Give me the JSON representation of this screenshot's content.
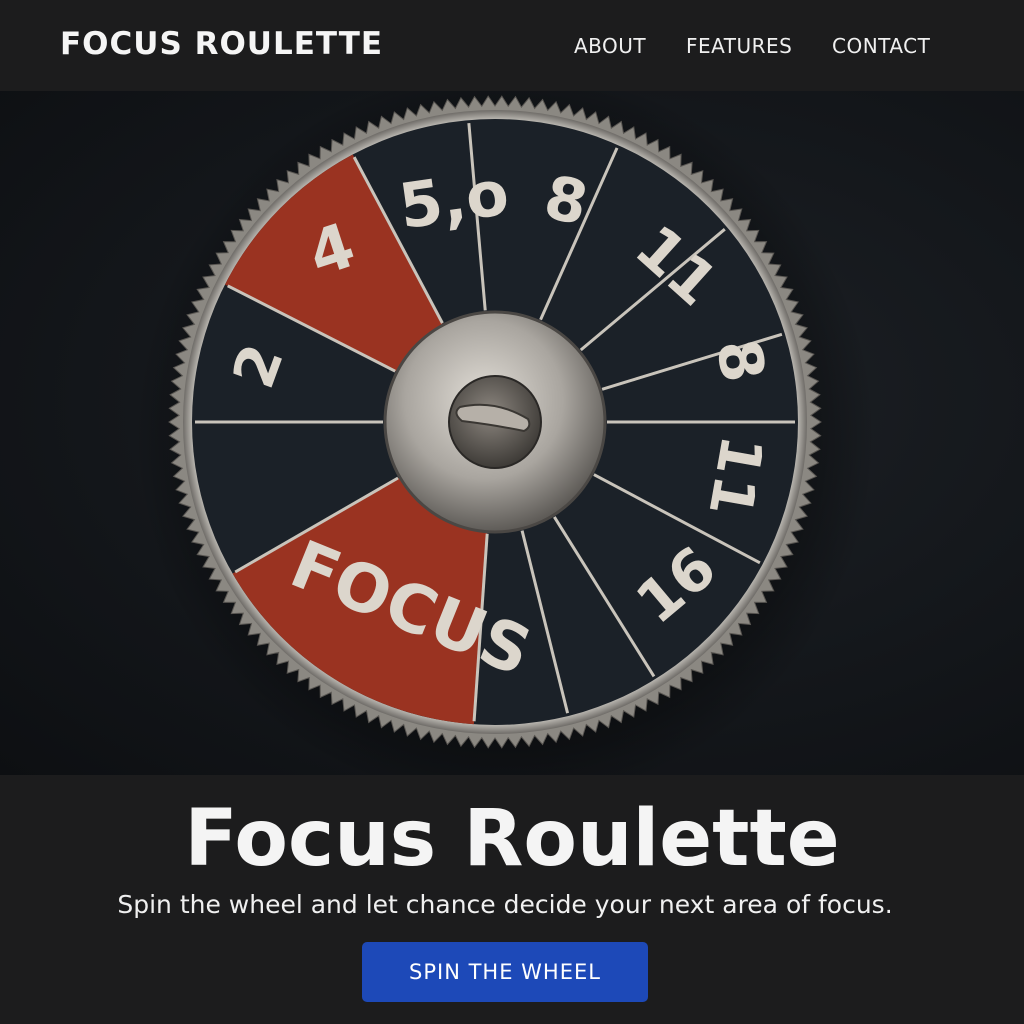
{
  "nav": {
    "logo": "FOCUS ROULETTE",
    "links": [
      "ABOUT",
      "FEATURES",
      "CONTACT"
    ]
  },
  "wheel": {
    "segment_labels": [
      "5,o",
      "8",
      "11",
      "8",
      "11",
      "16",
      "FOCUS",
      "2",
      "4"
    ],
    "colors": {
      "dark": "#1b2128",
      "red": "#9a3321",
      "rim": "#b9b6b0",
      "text": "#dcd6cc"
    }
  },
  "hero": {
    "title": "Focus Roulette",
    "subtitle": "Spin the wheel and let chance decide your next area of focus.",
    "cta_label": "SPIN THE WHEEL"
  },
  "colors": {
    "cta": "#1d49b8",
    "background": "#1c1c1d"
  }
}
